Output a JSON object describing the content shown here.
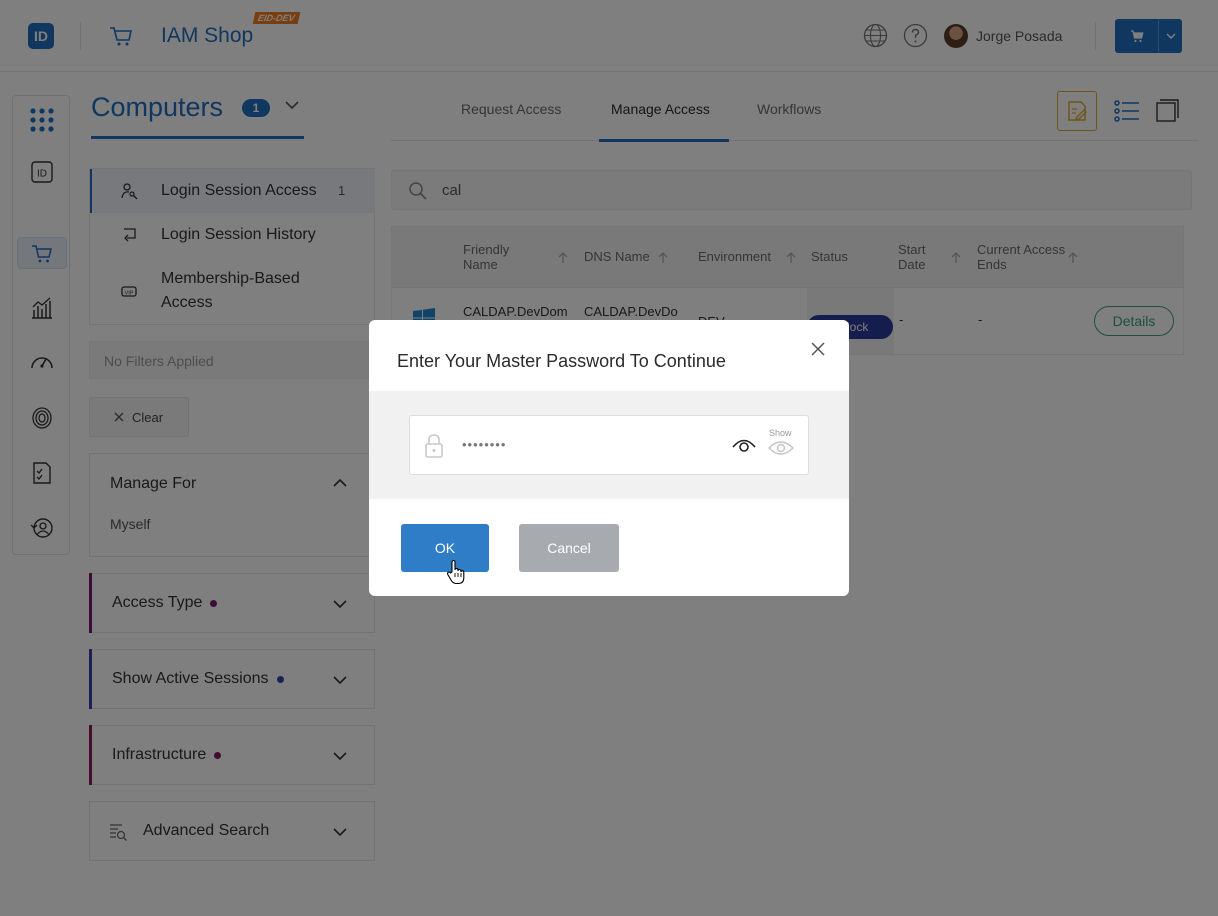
{
  "header": {
    "logo_text": "ID",
    "app_title": "IAM Shop",
    "env_badge": "EID-DEV",
    "user_name": "Jorge Posada",
    "accent_color": "#1f6fc1"
  },
  "page": {
    "title": "Computers",
    "title_count": "1",
    "tabs": [
      {
        "label": "Request Access"
      },
      {
        "label": "Manage Access"
      },
      {
        "label": "Workflows"
      }
    ],
    "active_tab": "Manage Access"
  },
  "subnav": {
    "items": [
      {
        "label": "Login Session Access",
        "count": "1",
        "icon": "key-person-icon"
      },
      {
        "label": "Login Session History",
        "icon": "history-icon"
      },
      {
        "label": "Membership-Based Access",
        "icon": "vip-card-icon"
      }
    ]
  },
  "filters": {
    "status_text": "No Filters Applied",
    "clear_label": "Clear"
  },
  "cards": {
    "manage_for": {
      "label": "Manage For",
      "value": "Myself"
    },
    "access_type": {
      "label": "Access Type",
      "dot_color": "#7a1a6e"
    },
    "active_sessions": {
      "label": "Show Active Sessions",
      "dot_color": "#3b3fb2"
    },
    "infrastructure": {
      "label": "Infrastructure",
      "dot_color": "#8a1a5a"
    },
    "advanced_search": {
      "label": "Advanced Search"
    }
  },
  "search": {
    "value": "cal"
  },
  "table": {
    "columns": [
      "Friendly Name",
      "DNS Name",
      "Environment",
      "Status",
      "Start Date",
      "Current Access Ends"
    ],
    "rows": [
      {
        "friendly_name": "CALDAP.DevDom",
        "dns_name": "CALDAP.DevDo",
        "environment": "DEV",
        "status": "Unlock",
        "start_date": "-",
        "access_ends": "-",
        "action": "Details"
      }
    ]
  },
  "modal": {
    "title": "Enter Your Master Password To Continue",
    "password_mask": "••••••••",
    "show_label": "Show",
    "ok_label": "OK",
    "cancel_label": "Cancel"
  }
}
